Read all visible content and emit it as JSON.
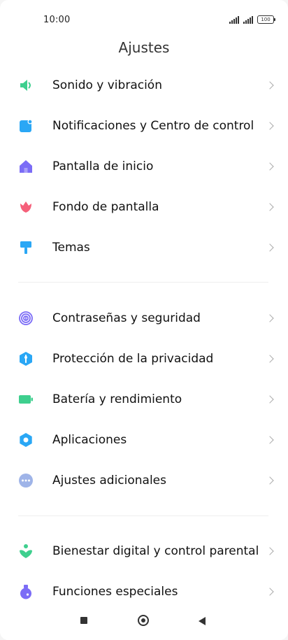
{
  "status_bar": {
    "time": "10:00",
    "battery": "100"
  },
  "header": {
    "title": "Ajustes"
  },
  "groups": [
    {
      "items": [
        {
          "label": "Sonido y vibración",
          "icon": "speaker-icon",
          "color": "#3ecf8e"
        },
        {
          "label": "Notificaciones y Centro de control",
          "icon": "notification-icon",
          "color": "#2aa7f5"
        },
        {
          "label": "Pantalla de inicio",
          "icon": "home-icon",
          "color": "#7b6cf6"
        },
        {
          "label": "Fondo de pantalla",
          "icon": "tulip-icon",
          "color": "#f5607a"
        },
        {
          "label": "Temas",
          "icon": "brush-icon",
          "color": "#2aa7f5"
        }
      ]
    },
    {
      "items": [
        {
          "label": "Contraseñas y seguridad",
          "icon": "fingerprint-icon",
          "color": "#7b6cf6"
        },
        {
          "label": "Protección de la privacidad",
          "icon": "shield-icon",
          "color": "#2aa7f5"
        },
        {
          "label": "Batería y rendimiento",
          "icon": "battery-icon",
          "color": "#3ecf8e"
        },
        {
          "label": "Aplicaciones",
          "icon": "gear-icon",
          "color": "#2aa7f5"
        },
        {
          "label": "Ajustes adicionales",
          "icon": "more-icon",
          "color": "#9fb4e8"
        }
      ]
    },
    {
      "items": [
        {
          "label": "Bienestar digital y control parental",
          "icon": "wellbeing-icon",
          "color": "#3ecf8e"
        },
        {
          "label": "Funciones especiales",
          "icon": "potion-icon",
          "color": "#7b6cf6"
        }
      ]
    }
  ]
}
